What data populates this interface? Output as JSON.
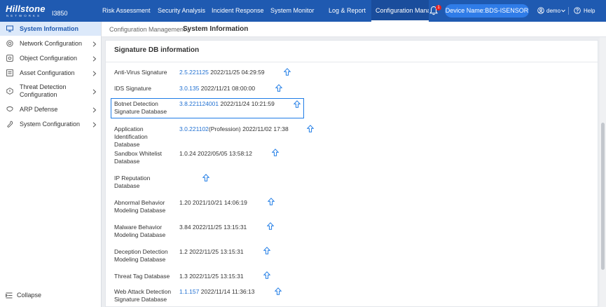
{
  "brand": {
    "name": "Hillstone",
    "sub": "NETWORKS",
    "model": "I3850"
  },
  "nav": {
    "items": [
      "Risk Assessment",
      "Security Analysis",
      "Incident Response",
      "System Monitor",
      "Log & Report",
      "Configuration Manag"
    ],
    "notification_count": "1",
    "device_name": "Device Name:BDS-ISENSOR",
    "user": "demo",
    "help": "Help"
  },
  "sidebar": {
    "items": [
      {
        "label": "System Information",
        "icon": "display-icon"
      },
      {
        "label": "Network Configuration",
        "icon": "globe-icon"
      },
      {
        "label": "Object Configuration",
        "icon": "object-icon"
      },
      {
        "label": "Asset Configuration",
        "icon": "asset-icon"
      },
      {
        "label": "Threat Detection Configuration",
        "icon": "threat-icon"
      },
      {
        "label": "ARP Defense",
        "icon": "arp-icon"
      },
      {
        "label": "System Configuration",
        "icon": "wrench-icon"
      }
    ],
    "collapse": "Collapse"
  },
  "breadcrumb": {
    "parent": "Configuration Management /",
    "current": "System Information"
  },
  "section_title": "Signature DB information",
  "signatures": [
    {
      "label": "Anti-Virus Signature",
      "version": "2.5.221125",
      "suffix": "",
      "date": "2022/11/25 04:29:59"
    },
    {
      "label": "IDS Signature",
      "version": "3.0.135",
      "suffix": "",
      "date": "2022/11/21 08:00:00"
    },
    {
      "label": "Botnet Detection Signature Database",
      "version": "3.8.221124001",
      "suffix": "",
      "date": "2022/11/24 10:21:59"
    },
    {
      "label": "Application Identification Database",
      "version": "3.0.221102",
      "suffix": "(Profession)",
      "date": "2022/11/02 17:38"
    },
    {
      "label": "Sandbox Whitelist Database",
      "version": "",
      "suffix": "1.0.24",
      "date": "2022/05/05 13:58:12"
    },
    {
      "label": "IP Reputation Database",
      "version": "",
      "suffix": "",
      "date": ""
    },
    {
      "label": "Abnormal Behavior Modeling Database",
      "version": "",
      "suffix": "1.20",
      "date": "2021/10/21 14:06:19"
    },
    {
      "label": "Malware Behavior Modeling Database",
      "version": "",
      "suffix": "3.84",
      "date": "2022/11/25 13:15:31"
    },
    {
      "label": "Deception Detection Modeling Database",
      "version": "",
      "suffix": "1.2",
      "date": "2022/11/25 13:15:31"
    },
    {
      "label": "Threat Tag Database",
      "version": "",
      "suffix": "1.3",
      "date": "2022/11/25 13:15:31"
    },
    {
      "label": "Web Attack Detection Signature Database",
      "version": "1.1.157",
      "suffix": "",
      "date": "2022/11/14 11:36:13"
    }
  ],
  "colors": {
    "topbar": "#1f5ab1",
    "accent": "#1f6fd1",
    "device_pill": "#2f7ce8",
    "badge": "#e32222"
  }
}
